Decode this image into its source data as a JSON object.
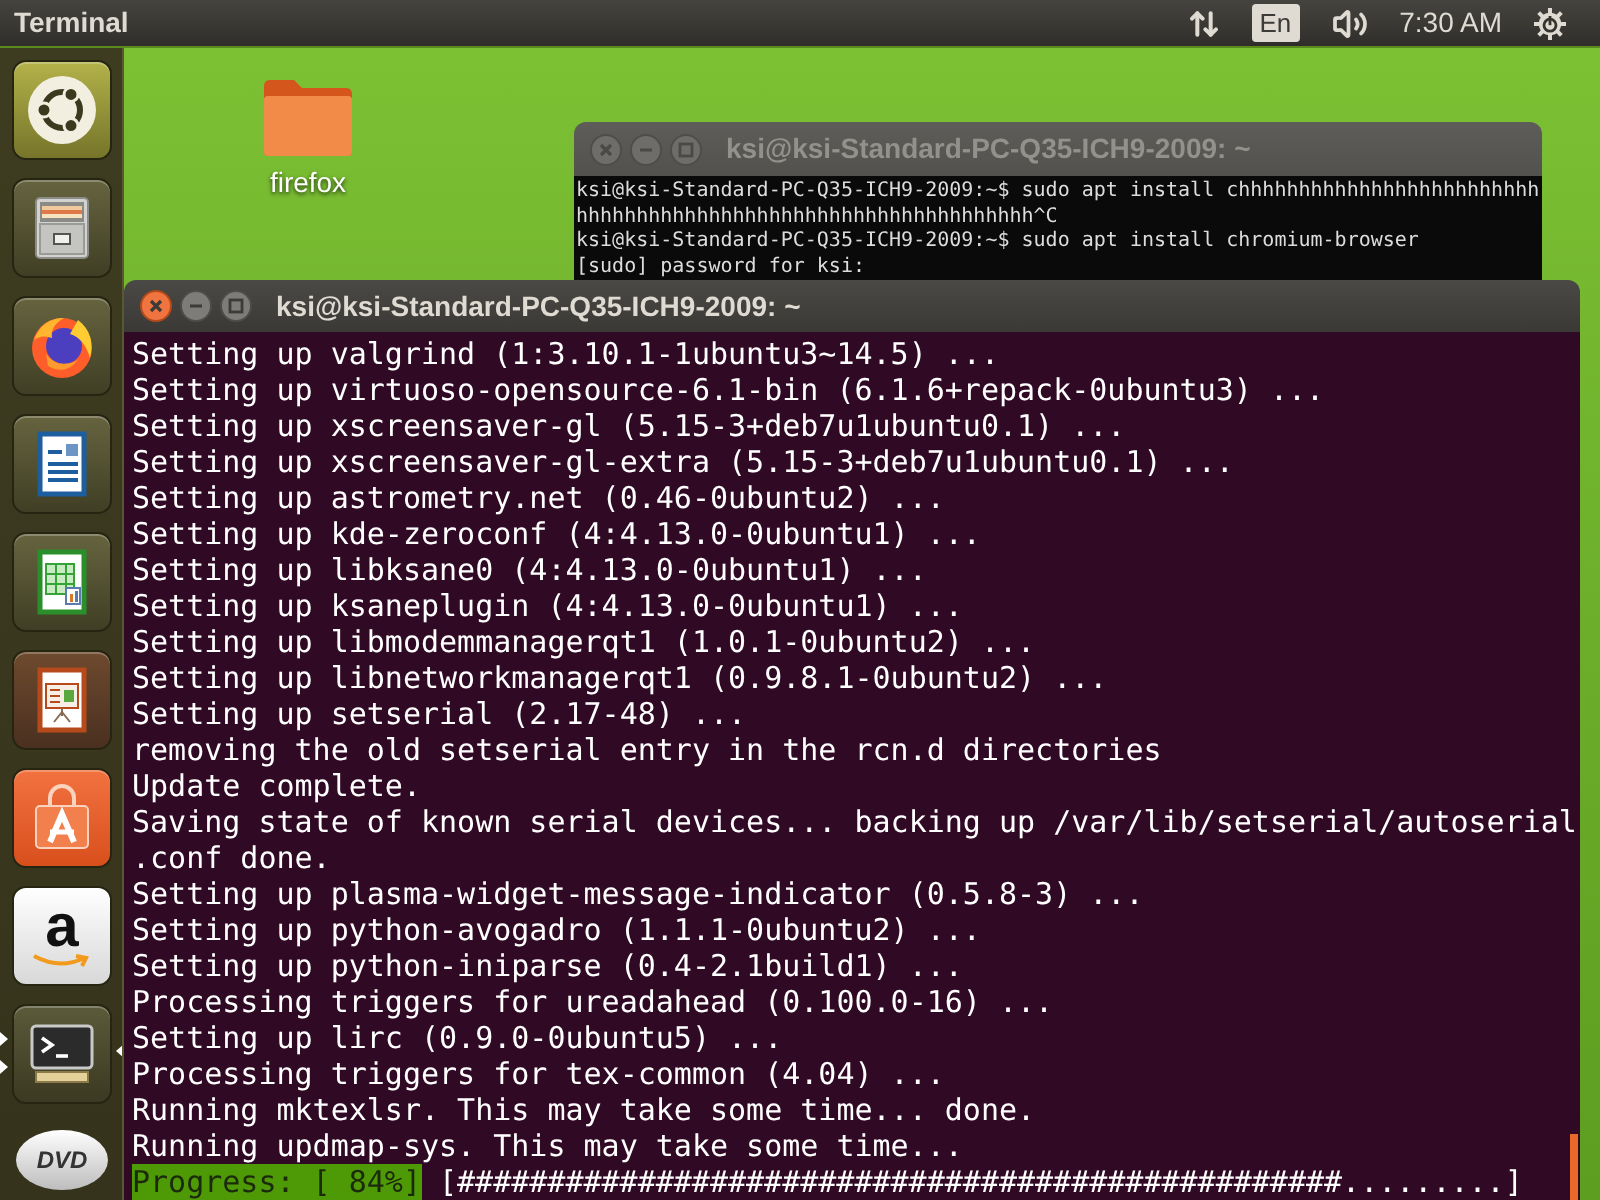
{
  "top_bar": {
    "app_title": "Terminal",
    "indicators": [
      {
        "kind": "network"
      },
      {
        "kind": "keyboard",
        "label": "En"
      },
      {
        "kind": "volume"
      },
      {
        "kind": "clock",
        "label": "7:30 AM"
      },
      {
        "kind": "session"
      }
    ]
  },
  "launcher": {
    "items": [
      {
        "kind": "dash",
        "running": false,
        "focused": false
      },
      {
        "kind": "files",
        "running": false,
        "focused": false
      },
      {
        "kind": "browser",
        "running": false,
        "focused": false
      },
      {
        "kind": "writer",
        "running": false,
        "focused": false
      },
      {
        "kind": "calc",
        "running": false,
        "focused": false
      },
      {
        "kind": "impress",
        "running": false,
        "focused": false
      },
      {
        "kind": "software",
        "running": false,
        "focused": false
      },
      {
        "kind": "shop",
        "glyph": "a",
        "running": false,
        "focused": false
      },
      {
        "kind": "terminal",
        "running": true,
        "focused": true
      },
      {
        "kind": "dvd",
        "glyph": "DVD",
        "running": false,
        "focused": false
      }
    ]
  },
  "desktop_icons": [
    {
      "label": "firefox"
    }
  ],
  "windows": [
    {
      "title": "ksi@ksi-Standard-PC-Q35-ICH9-2009: ~",
      "focused": false,
      "lines": [
        "ksi@ksi-Standard-PC-Q35-ICH9-2009:~$ sudo apt install chhhhhhhhhhhhhhhhhhhhhhhhh",
        "hhhhhhhhhhhhhhhhhhhhhhhhhhhhhhhhhhhhhh^C",
        "ksi@ksi-Standard-PC-Q35-ICH9-2009:~$ sudo apt install chromium-browser",
        "[sudo] password for ksi:"
      ]
    },
    {
      "title": "ksi@ksi-Standard-PC-Q35-ICH9-2009: ~",
      "focused": true,
      "lines": [
        "Setting up valgrind (1:3.10.1-1ubuntu3~14.5) ...",
        "Setting up virtuoso-opensource-6.1-bin (6.1.6+repack-0ubuntu3) ...",
        "Setting up xscreensaver-gl (5.15-3+deb7u1ubuntu0.1) ...",
        "Setting up xscreensaver-gl-extra (5.15-3+deb7u1ubuntu0.1) ...",
        "Setting up astrometry.net (0.46-0ubuntu2) ...",
        "Setting up kde-zeroconf (4:4.13.0-0ubuntu1) ...",
        "Setting up libksane0 (4:4.13.0-0ubuntu1) ...",
        "Setting up ksaneplugin (4:4.13.0-0ubuntu1) ...",
        "Setting up libmodemmanagerqt1 (1.0.1-0ubuntu2) ...",
        "Setting up libnetworkmanagerqt1 (0.9.8.1-0ubuntu2) ...",
        "Setting up setserial (2.17-48) ...",
        "removing the old setserial entry in the rcn.d directories",
        "Update complete.",
        "Saving state of known serial devices... backing up /var/lib/setserial/autoserial",
        ".conf done.",
        "Setting up plasma-widget-message-indicator (0.5.8-3) ...",
        "Setting up python-avogadro (1.1.1-0ubuntu2) ...",
        "Setting up python-iniparse (0.4-2.1build1) ...",
        "Processing triggers for ureadahead (0.100.0-16) ...",
        "Setting up lirc (0.9.0-0ubuntu5) ...",
        "Processing triggers for tex-common (4.04) ...",
        "Running mktexlsr. This may take some time... done.",
        "Running updmap-sys. This may take some time..."
      ],
      "progress": {
        "label": "Progress: [ 84%]",
        "bar": "[#################################################.........]"
      }
    }
  ]
}
